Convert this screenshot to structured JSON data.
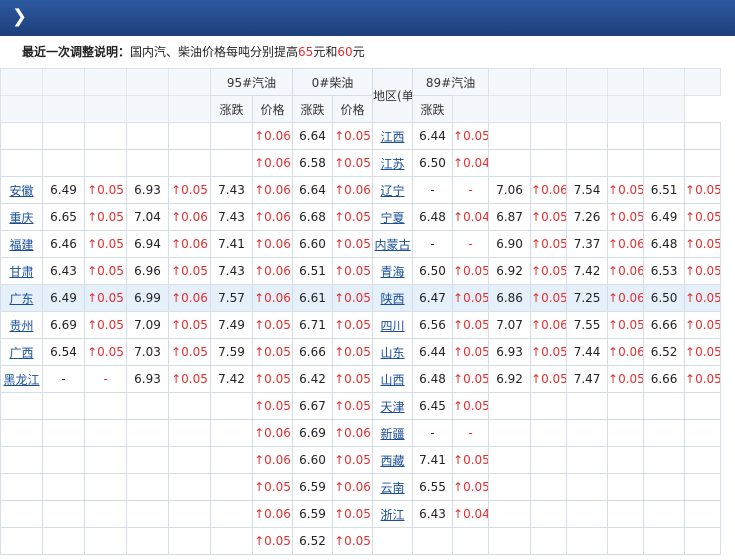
{
  "header": {
    "chevron_icon": "chevron-right-icon"
  },
  "notice": {
    "label": "最近一次调整说明：",
    "text_a": "国内汽、柴油价格每吨分别提高",
    "n1": "65",
    "text_b": "元和",
    "n2": "60",
    "text_c": "元"
  },
  "columns": {
    "h95": "95#汽油",
    "h0": "0#柴油",
    "region_unit": "地区(单位:元/升)",
    "h89": "89#汽油",
    "price": "价格",
    "change": "涨跌"
  },
  "rows": [
    {
      "r1": "",
      "c": [
        "",
        "",
        "",
        "",
        "",
        ""
      ],
      "p95": "",
      "u95": "↑0.06",
      "p0": "6.64",
      "u0": "↑0.05",
      "r2": "江西",
      "p89": "6.44",
      "u89": "↑0.05",
      "t": [
        "",
        "",
        "",
        "",
        "",
        ""
      ]
    },
    {
      "r1": "",
      "c": [
        "",
        "",
        "",
        "",
        "",
        ""
      ],
      "p95": "",
      "u95": "↑0.06",
      "p0": "6.58",
      "u0": "↑0.05",
      "r2": "江苏",
      "p89": "6.50",
      "u89": "↑0.04",
      "t": [
        "",
        "",
        "",
        "",
        "",
        ""
      ]
    },
    {
      "r1": "安徽",
      "c": [
        "6.49",
        "↑0.05",
        "6.93",
        "↑0.05"
      ],
      "p95": "7.43",
      "u95": "↑0.06",
      "p0": "6.64",
      "u0": "↑0.06",
      "r2": "辽宁",
      "p89": "-",
      "u89": "-",
      "t": [
        "7.06",
        "↑0.06",
        "7.54",
        "↑0.05",
        "6.51",
        "↑0.05"
      ]
    },
    {
      "r1": "重庆",
      "c": [
        "6.65",
        "↑0.05",
        "7.04",
        "↑0.06"
      ],
      "p95": "7.43",
      "u95": "↑0.06",
      "p0": "6.68",
      "u0": "↑0.05",
      "r2": "宁夏",
      "p89": "6.48",
      "u89": "↑0.04",
      "t": [
        "6.87",
        "↑0.05",
        "7.26",
        "↑0.05",
        "6.49",
        "↑0.05"
      ]
    },
    {
      "r1": "福建",
      "c": [
        "6.46",
        "↑0.05",
        "6.94",
        "↑0.06"
      ],
      "p95": "7.41",
      "u95": "↑0.06",
      "p0": "6.60",
      "u0": "↑0.05",
      "r2": "内蒙古",
      "p89": "-",
      "u89": "-",
      "t": [
        "6.90",
        "↑0.05",
        "7.37",
        "↑0.06",
        "6.48",
        "↑0.05"
      ]
    },
    {
      "r1": "甘肃",
      "c": [
        "6.43",
        "↑0.05",
        "6.96",
        "↑0.05"
      ],
      "p95": "7.43",
      "u95": "↑0.06",
      "p0": "6.51",
      "u0": "↑0.05",
      "r2": "青海",
      "p89": "6.50",
      "u89": "↑0.05",
      "t": [
        "6.92",
        "↑0.05",
        "7.42",
        "↑0.06",
        "6.53",
        "↑0.05"
      ]
    },
    {
      "r1": "广东",
      "c": [
        "6.49",
        "↑0.05",
        "6.99",
        "↑0.06"
      ],
      "p95": "7.57",
      "u95": "↑0.06",
      "p0": "6.61",
      "u0": "↑0.05",
      "r2": "陕西",
      "p89": "6.47",
      "u89": "↑0.05",
      "t": [
        "6.86",
        "↑0.05",
        "7.25",
        "↑0.06",
        "6.50",
        "↑0.05"
      ]
    },
    {
      "r1": "贵州",
      "c": [
        "6.69",
        "↑0.05",
        "7.09",
        "↑0.05"
      ],
      "p95": "7.49",
      "u95": "↑0.05",
      "p0": "6.71",
      "u0": "↑0.05",
      "r2": "四川",
      "p89": "6.56",
      "u89": "↑0.05",
      "t": [
        "7.07",
        "↑0.06",
        "7.55",
        "↑0.05",
        "6.66",
        "↑0.05"
      ]
    },
    {
      "r1": "广西",
      "c": [
        "6.54",
        "↑0.05",
        "7.03",
        "↑0.05"
      ],
      "p95": "7.59",
      "u95": "↑0.05",
      "p0": "6.66",
      "u0": "↑0.05",
      "r2": "山东",
      "p89": "6.44",
      "u89": "↑0.05",
      "t": [
        "6.93",
        "↑0.05",
        "7.44",
        "↑0.06",
        "6.52",
        "↑0.05"
      ]
    },
    {
      "r1": "黑龙江",
      "c": [
        "-",
        "-",
        "6.93",
        "↑0.05"
      ],
      "p95": "7.42",
      "u95": "↑0.05",
      "p0": "6.42",
      "u0": "↑0.05",
      "r2": "山西",
      "p89": "6.48",
      "u89": "↑0.05",
      "t": [
        "6.92",
        "↑0.05",
        "7.47",
        "↑0.05",
        "6.66",
        "↑0.05"
      ]
    },
    {
      "r1": "",
      "c": [
        "",
        "",
        "",
        ""
      ],
      "p95": "",
      "u95": "↑0.05",
      "p0": "6.67",
      "u0": "↑0.05",
      "r2": "天津",
      "p89": "6.45",
      "u89": "↑0.05",
      "t": [
        "",
        "",
        "",
        "",
        "",
        ""
      ]
    },
    {
      "r1": "",
      "c": [
        "",
        "",
        "",
        ""
      ],
      "p95": "",
      "u95": "↑0.06",
      "p0": "6.69",
      "u0": "↑0.06",
      "r2": "新疆",
      "p89": "-",
      "u89": "-",
      "t": [
        "",
        "",
        "",
        "",
        "",
        ""
      ]
    },
    {
      "r1": "",
      "c": [
        "",
        "",
        "",
        ""
      ],
      "p95": "",
      "u95": "↑0.06",
      "p0": "6.60",
      "u0": "↑0.05",
      "r2": "西藏",
      "p89": "7.41",
      "u89": "↑0.05",
      "t": [
        "",
        "",
        "",
        "",
        "",
        ""
      ]
    },
    {
      "r1": "",
      "c": [
        "",
        "",
        "",
        ""
      ],
      "p95": "",
      "u95": "↑0.05",
      "p0": "6.59",
      "u0": "↑0.06",
      "r2": "云南",
      "p89": "6.55",
      "u89": "↑0.05",
      "t": [
        "",
        "",
        "",
        "",
        "",
        ""
      ]
    },
    {
      "r1": "",
      "c": [
        "",
        "",
        "",
        ""
      ],
      "p95": "",
      "u95": "↑0.06",
      "p0": "6.59",
      "u0": "↑0.05",
      "r2": "浙江",
      "p89": "6.43",
      "u89": "↑0.04",
      "t": [
        "",
        "",
        "",
        "",
        "",
        ""
      ]
    },
    {
      "r1": "",
      "c": [
        "",
        "",
        "",
        ""
      ],
      "p95": "",
      "u95": "↑0.05",
      "p0": "6.52",
      "u0": "↑0.05",
      "r2": "",
      "p89": "",
      "u89": "",
      "t": [
        "",
        "",
        "",
        "",
        "",
        ""
      ]
    }
  ]
}
